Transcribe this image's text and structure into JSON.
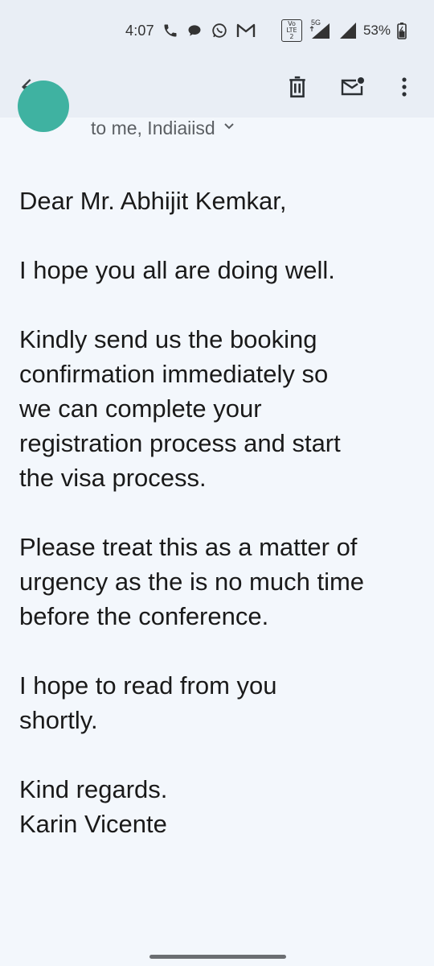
{
  "status_bar": {
    "time": "4:07",
    "network_badge_top": "Vo",
    "network_badge_mid": "LTE 2",
    "network_label": "5G",
    "battery_percent": "53%"
  },
  "toolbar": {
    "back_icon": "arrow-left-icon",
    "delete_icon": "trash-icon",
    "mark_unread_icon": "mail-unread-icon",
    "more_icon": "more-vert-icon"
  },
  "sender": {
    "avatar_color": "#3fb2a1",
    "recipients": "to me, Indiaiisd"
  },
  "email": {
    "greeting": "Dear Mr. Abhijit Kemkar,",
    "para1": "I hope you all are doing well.",
    "para2_lines": [
      "Kindly send us the booking",
      "confirmation immediately so",
      "we can complete your",
      "registration process and start",
      "the visa process."
    ],
    "para3_lines": [
      "Please treat this as a matter of",
      "urgency as the is no much time",
      "before the conference."
    ],
    "para4_lines": [
      "I hope to read from you",
      "shortly."
    ],
    "closing": "Kind regards.",
    "signature": "Karin Vicente"
  }
}
